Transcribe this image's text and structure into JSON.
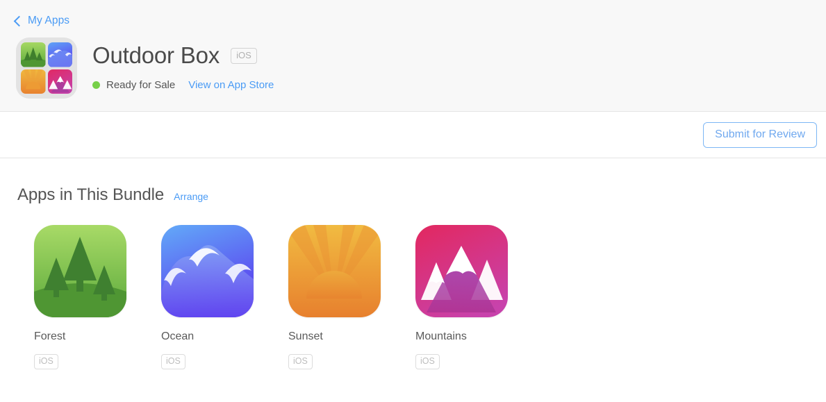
{
  "breadcrumb": {
    "back_icon": "chevron-left-icon",
    "label": "My Apps"
  },
  "app": {
    "title": "Outdoor Box",
    "platform_badge": "iOS",
    "status": "Ready for Sale",
    "status_color": "#77d049",
    "store_link": "View on App Store",
    "icon": "bundle-grid-icon"
  },
  "toolbar": {
    "submit_label": "Submit for Review",
    "accent_color": "#7cb6f5"
  },
  "section": {
    "title": "Apps in This Bundle",
    "arrange_label": "Arrange"
  },
  "apps": [
    {
      "name": "Forest",
      "platform": "iOS",
      "icon": "forest-icon",
      "color_from": "#a5d863",
      "color_to": "#5aa83a"
    },
    {
      "name": "Ocean",
      "platform": "iOS",
      "icon": "ocean-icon",
      "color_from": "#5fa4f7",
      "color_to": "#5b3bef"
    },
    {
      "name": "Sunset",
      "platform": "iOS",
      "icon": "sunset-icon",
      "color_from": "#f0b93f",
      "color_to": "#e8812f"
    },
    {
      "name": "Mountains",
      "platform": "iOS",
      "icon": "mountains-icon",
      "color_from": "#e02a66",
      "color_to": "#c740a8"
    }
  ]
}
